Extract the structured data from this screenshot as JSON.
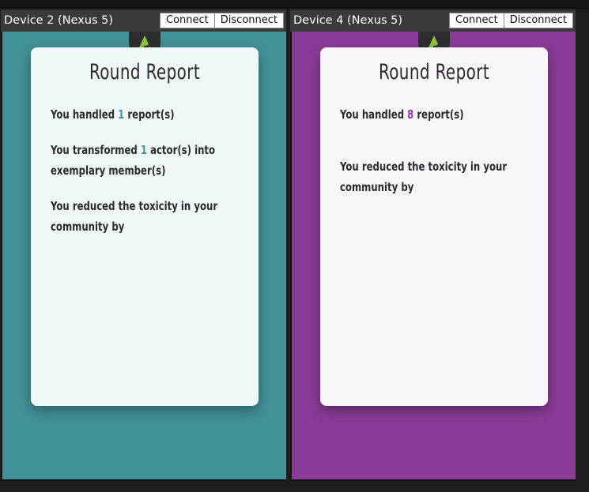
{
  "colors": {
    "teal": "#42929a",
    "purple": "#8a3c98",
    "titlebar": "#3a3a3a",
    "logo_green": "#8dc63f"
  },
  "devices": [
    {
      "title": "Device 2 (Nexus 5)",
      "connect_label": "Connect",
      "disconnect_label": "Disconnect",
      "logo_icon": "app-logo-icon",
      "card": {
        "title": "Round Report",
        "handled_prefix": "You handled",
        "handled_count": "1",
        "handled_suffix": "report(s)",
        "transformed_prefix": "You transformed",
        "transformed_count": "1",
        "transformed_suffix_1": "actor(s) into",
        "transformed_suffix_2": "exemplary member(s)",
        "toxicity_line_1": "You reduced the toxicity in your",
        "toxicity_line_2": "community by"
      }
    },
    {
      "title": "Device 4 (Nexus 5)",
      "connect_label": "Connect",
      "disconnect_label": "Disconnect",
      "logo_icon": "app-logo-icon",
      "card": {
        "title": "Round Report",
        "handled_prefix": "You handled",
        "handled_count": "8",
        "handled_suffix": "report(s)",
        "toxicity_line_1": "You reduced the toxicity in your",
        "toxicity_line_2": "community by"
      }
    }
  ]
}
